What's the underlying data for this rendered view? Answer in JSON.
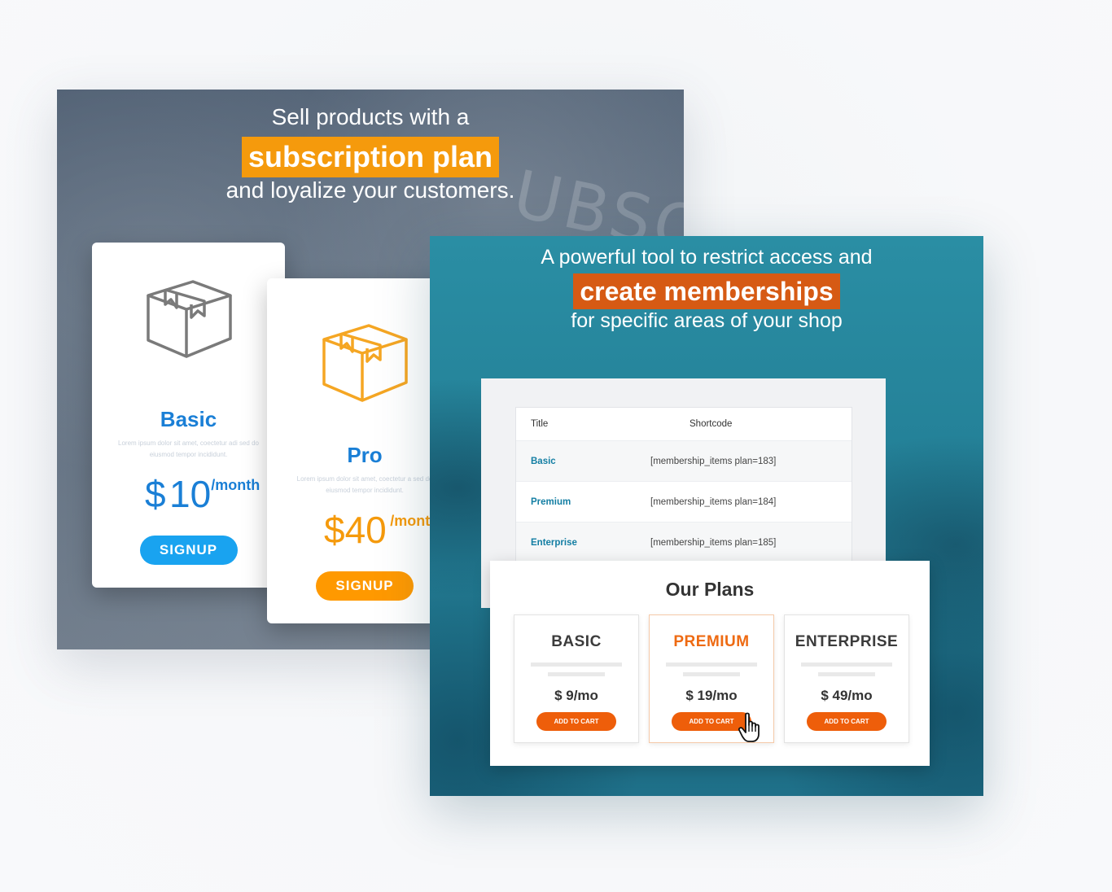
{
  "left_panel": {
    "headline_line1": "Sell products with a",
    "headline_highlight": "subscription plan",
    "headline_line3": "and loyalize your customers.",
    "watermark": "UBSC",
    "cards": [
      {
        "name": "Basic",
        "lorem": "Lorem ipsum dolor sit amet, coectetur adi sed do eiusmod tempor incididunt.",
        "currency": "$",
        "amount": "10",
        "period": "/month",
        "button": "SIGNUP",
        "icon": "box-icon",
        "color": "#1a7fd6"
      },
      {
        "name": "Pro",
        "lorem": "Lorem ipsum dolor sit amet, coectetur a sed do eiusmod tempor incididunt.",
        "currency": "$",
        "amount": "40",
        "period": "/mont",
        "button": "SIGNUP",
        "icon": "box-icon",
        "color": "#f59a0c"
      }
    ],
    "highlight_color": "#f59a0c"
  },
  "right_panel": {
    "headline_line1": "A powerful tool to restrict access and",
    "headline_highlight": "create memberships",
    "headline_line3": "for specific areas of your shop",
    "highlight_color": "#d65a14",
    "table": {
      "headers": [
        "Title",
        "Shortcode"
      ],
      "rows": [
        {
          "title": "Basic",
          "shortcode": "[membership_items plan=183]"
        },
        {
          "title": "Premium",
          "shortcode": "[membership_items plan=184]"
        },
        {
          "title": "Enterprise",
          "shortcode": "[membership_items plan=185]"
        }
      ]
    },
    "plans": {
      "title": "Our Plans",
      "items": [
        {
          "name": "BASIC",
          "price": "$ 9/mo",
          "button": "ADD TO CART"
        },
        {
          "name": "PREMIUM",
          "price": "$ 19/mo",
          "button": "ADD TO CART"
        },
        {
          "name": "ENTERPRISE",
          "price": "$ 49/mo",
          "button": "ADD TO CART"
        }
      ]
    },
    "cursor_icon": "hand-pointer-icon"
  }
}
